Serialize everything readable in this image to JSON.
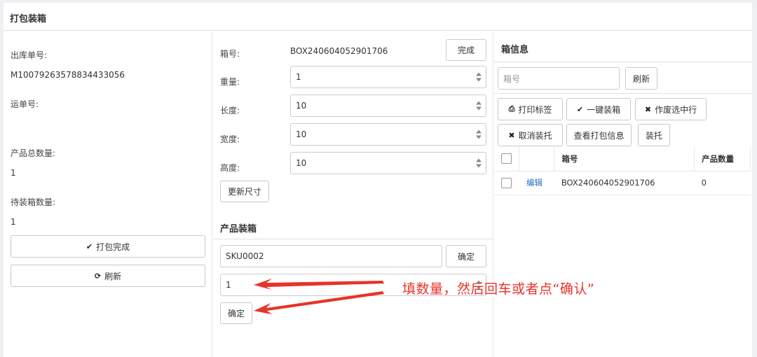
{
  "header": {
    "title": "打包装箱"
  },
  "left": {
    "outbound_label": "出库单号:",
    "outbound_value": "M10079263578834433056",
    "waybill_label": "运单号:",
    "total_qty_label": "产品总数量:",
    "total_qty_value": "1",
    "pending_qty_label": "待装箱数量:",
    "pending_qty_value": "1",
    "finish_button": "打包完成",
    "refresh_button": "刷新"
  },
  "middle": {
    "box_no_label": "箱号:",
    "box_no_value": "BOX240604052901706",
    "done_button": "完成",
    "weight_label": "重量:",
    "weight_value": "1",
    "length_label": "长度:",
    "length_value": "10",
    "width_label": "宽度:",
    "width_value": "10",
    "height_label": "高度:",
    "height_value": "10",
    "update_size_button": "更新尺寸",
    "packing_title": "产品装箱",
    "sku_value": "SKU0002",
    "sku_confirm_button": "确定",
    "qty_value": "1",
    "confirm_button": "确定"
  },
  "right": {
    "title": "箱信息",
    "box_search_placeholder": "箱号",
    "refresh_button": "刷新",
    "print_label_button": "打印标签",
    "one_click_pack_button": "一键装箱",
    "void_selected_button": "作废选中行",
    "cancel_pallet_button": "取消装托",
    "view_pack_info_button": "查看打包信息",
    "pallet_button": "装托",
    "table": {
      "col_box_no": "箱号",
      "col_qty": "产品数量",
      "rows": [
        {
          "action": "编辑",
          "box_no": "BOX240604052901706",
          "qty": "0"
        }
      ]
    }
  },
  "annotation": {
    "text": "填数量，然后回车或者点“确认”",
    "color": "#e8322a"
  }
}
